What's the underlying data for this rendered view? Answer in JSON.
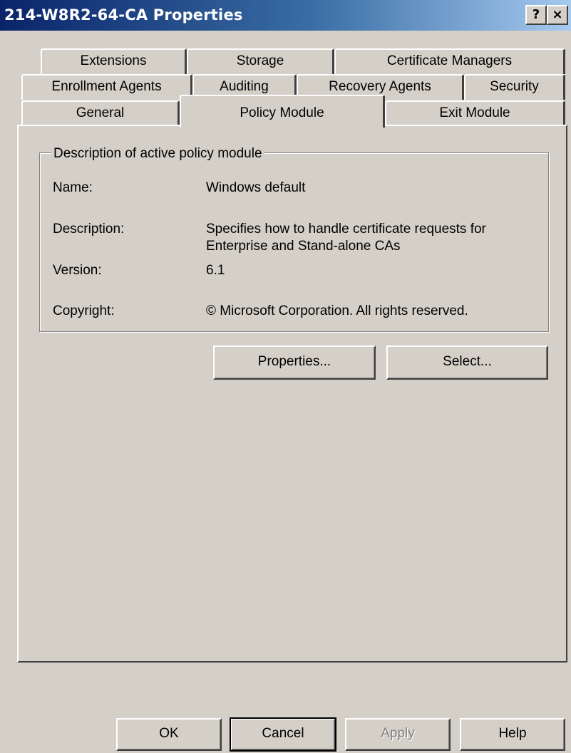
{
  "window": {
    "title": "214-W8R2-64-CA Properties",
    "help_btn": "?",
    "close_btn": "×"
  },
  "tabs": {
    "row1": [
      "Extensions",
      "Storage",
      "Certificate Managers"
    ],
    "row2": [
      "Enrollment Agents",
      "Auditing",
      "Recovery Agents",
      "Security"
    ],
    "row3": [
      "General",
      "Policy Module",
      "Exit Module"
    ],
    "active": "Policy Module"
  },
  "policy": {
    "group_title": "Description of active policy module",
    "name_label": "Name:",
    "name_value": "Windows default",
    "description_label": "Description:",
    "description_line1": "Specifies how to handle certificate requests for",
    "description_line2": "Enterprise and Stand-alone CAs",
    "version_label": "Version:",
    "version_value": "6.1",
    "copyright_label": "Copyright:",
    "copyright_value": "© Microsoft Corporation. All rights reserved.",
    "properties_button": "Properties...",
    "select_button": "Select..."
  },
  "footer": {
    "ok": "OK",
    "cancel": "Cancel",
    "apply": "Apply",
    "help": "Help"
  }
}
